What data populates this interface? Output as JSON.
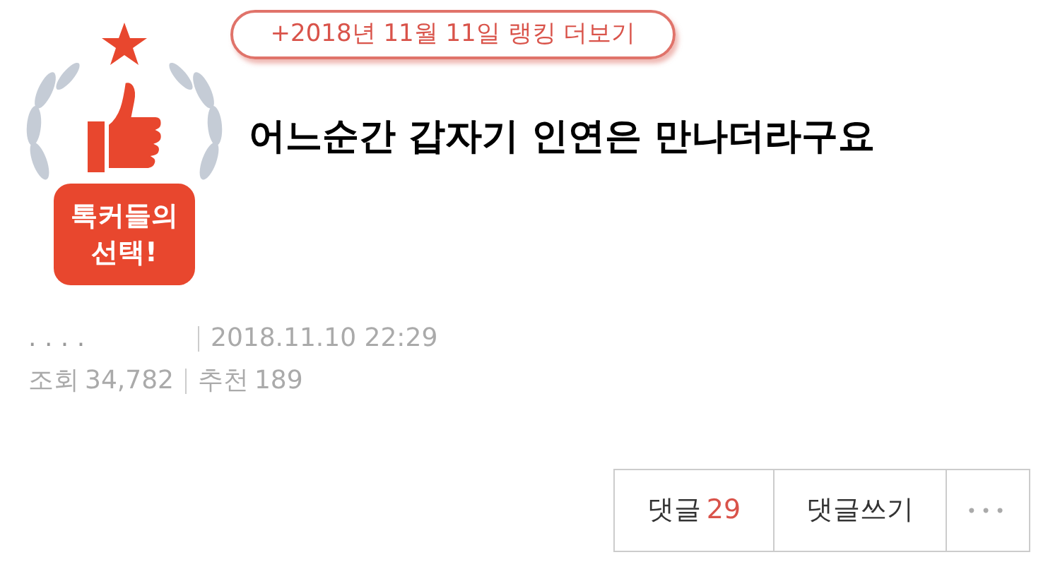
{
  "badge": {
    "lines": [
      "톡커들의",
      "선택!"
    ]
  },
  "ranking_link": "+2018년 11월 11일 랭킹 더보기",
  "title": "어느순간 갑자기 인연은 만나더라구요",
  "meta": {
    "author": ". . . .",
    "date": "2018.11.10 22:29",
    "views_label": "조회",
    "views": "34,782",
    "likes_label": "추천",
    "likes": "189"
  },
  "actions": {
    "comments_label": "댓글",
    "comments_count": "29",
    "write_comment": "댓글쓰기",
    "more": "•••"
  }
}
